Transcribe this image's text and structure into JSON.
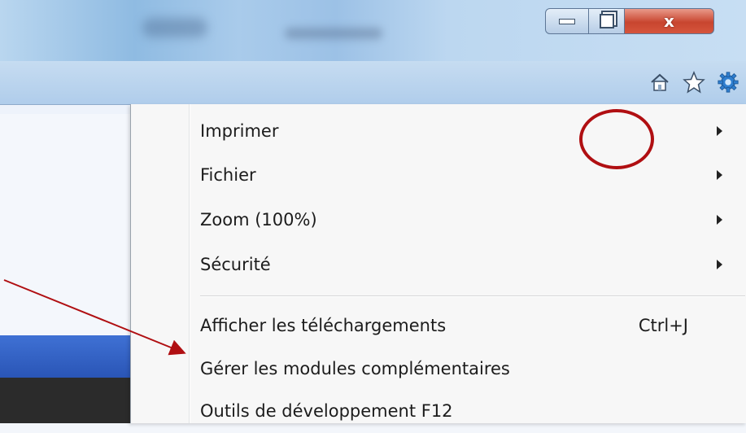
{
  "window": {
    "minimize_label": "minimize",
    "restore_label": "restore",
    "close_label": "x"
  },
  "toolbar": {
    "icons": [
      "home-icon",
      "star-icon",
      "gear-icon"
    ]
  },
  "menu": {
    "items": [
      {
        "label": "Imprimer",
        "submenu": true
      },
      {
        "label": "Fichier",
        "submenu": true
      },
      {
        "label": "Zoom (100%)",
        "submenu": true
      },
      {
        "label": "Sécurité",
        "submenu": true
      },
      {
        "label": "Afficher les téléchargements",
        "shortcut": "Ctrl+J"
      },
      {
        "label": "Gérer les modules complémentaires"
      },
      {
        "label": "Outils de développement F12"
      }
    ]
  },
  "annotation": {
    "circle_color": "#b00f12",
    "arrow_color": "#b00f12"
  }
}
